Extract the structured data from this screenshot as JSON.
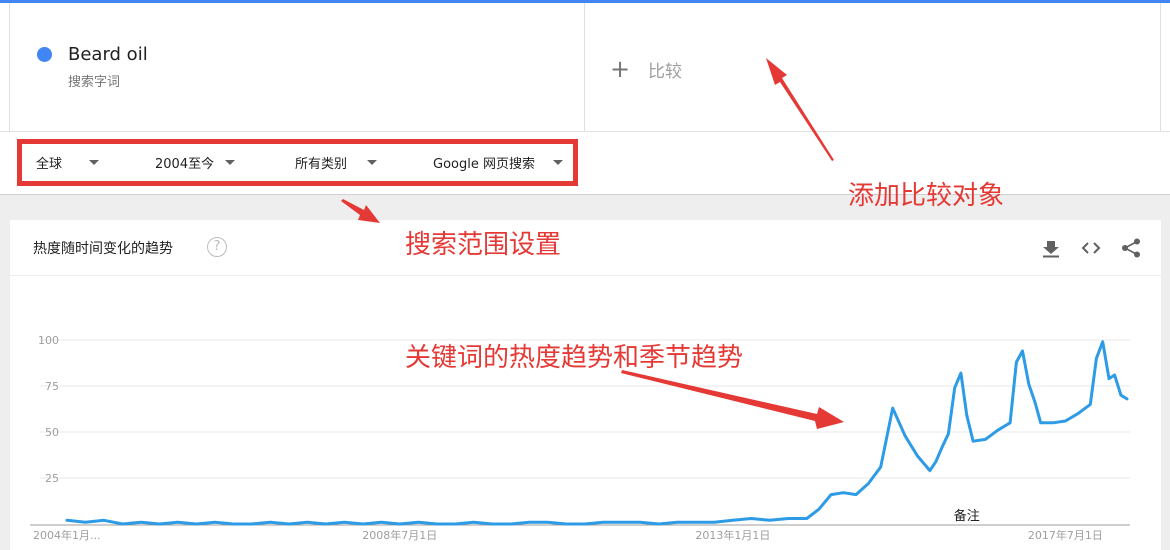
{
  "term": {
    "name": "Beard oil",
    "type": "搜索字词",
    "color": "#4285f4"
  },
  "compare": {
    "icon": "plus-icon",
    "label": "比较"
  },
  "filters": [
    {
      "label": "全球"
    },
    {
      "label": "2004至今"
    },
    {
      "label": "所有类别"
    },
    {
      "label": "Google 网页搜索"
    }
  ],
  "card": {
    "title": "热度随时间变化的趋势",
    "help": "?"
  },
  "tools": {
    "download": "download-icon",
    "embed": "embed-code-icon",
    "share": "share-icon"
  },
  "annotations": {
    "compare_note": "添加比较对象",
    "filter_note": "搜索范围设置",
    "trend_note": "关键词的热度趋势和季节趋势"
  },
  "chart_data": {
    "type": "line",
    "x": [
      "2004-01",
      "2004-04",
      "2004-07",
      "2004-10",
      "2005-01",
      "2005-04",
      "2005-07",
      "2005-10",
      "2006-01",
      "2006-04",
      "2006-07",
      "2006-10",
      "2007-01",
      "2007-04",
      "2007-07",
      "2007-10",
      "2008-01",
      "2008-04",
      "2008-07",
      "2008-10",
      "2009-01",
      "2009-04",
      "2009-07",
      "2009-10",
      "2010-01",
      "2010-04",
      "2010-07",
      "2010-10",
      "2011-01",
      "2011-04",
      "2011-07",
      "2011-10",
      "2012-01",
      "2012-04",
      "2012-07",
      "2012-10",
      "2013-01",
      "2013-04",
      "2013-07",
      "2013-10",
      "2014-01",
      "2014-03",
      "2014-05",
      "2014-07",
      "2014-09",
      "2014-11",
      "2015-01",
      "2015-03",
      "2015-05",
      "2015-07",
      "2015-09",
      "2015-10",
      "2015-11",
      "2015-12",
      "2016-01",
      "2016-02",
      "2016-03",
      "2016-04",
      "2016-06",
      "2016-08",
      "2016-10",
      "2016-11",
      "2016-12",
      "2017-01",
      "2017-02",
      "2017-03",
      "2017-05",
      "2017-07",
      "2017-09",
      "2017-11",
      "2017-12",
      "2018-01",
      "2018-02",
      "2018-03",
      "2018-04",
      "2018-05"
    ],
    "series": [
      {
        "values": [
          2,
          1,
          2,
          0,
          1,
          0,
          1,
          0,
          1,
          0,
          0,
          1,
          0,
          1,
          0,
          1,
          0,
          1,
          0,
          1,
          0,
          0,
          1,
          0,
          0,
          1,
          1,
          0,
          0,
          1,
          1,
          1,
          0,
          1,
          1,
          1,
          2,
          3,
          2,
          3,
          3,
          8,
          16,
          17,
          16,
          22,
          31,
          63,
          48,
          37,
          29,
          34,
          42,
          49,
          74,
          82,
          59,
          45,
          46,
          51,
          55,
          88,
          94,
          76,
          66,
          55,
          55,
          56,
          60,
          65,
          90,
          99,
          79,
          81,
          70,
          68
        ]
      }
    ],
    "ylim": [
      0,
      100
    ],
    "yticks": [
      25,
      50,
      75,
      100
    ],
    "xticks": [
      {
        "x": "2004-01",
        "label": "2004年1月..."
      },
      {
        "x": "2008-07",
        "label": "2008年7月1日"
      },
      {
        "x": "2013-01",
        "label": "2013年1月1日"
      },
      {
        "x": "2017-07",
        "label": "2017年7月1日"
      }
    ],
    "grid": true,
    "note": {
      "x": "2016-03",
      "label": "备注"
    },
    "line_color": "#2d9be5"
  }
}
